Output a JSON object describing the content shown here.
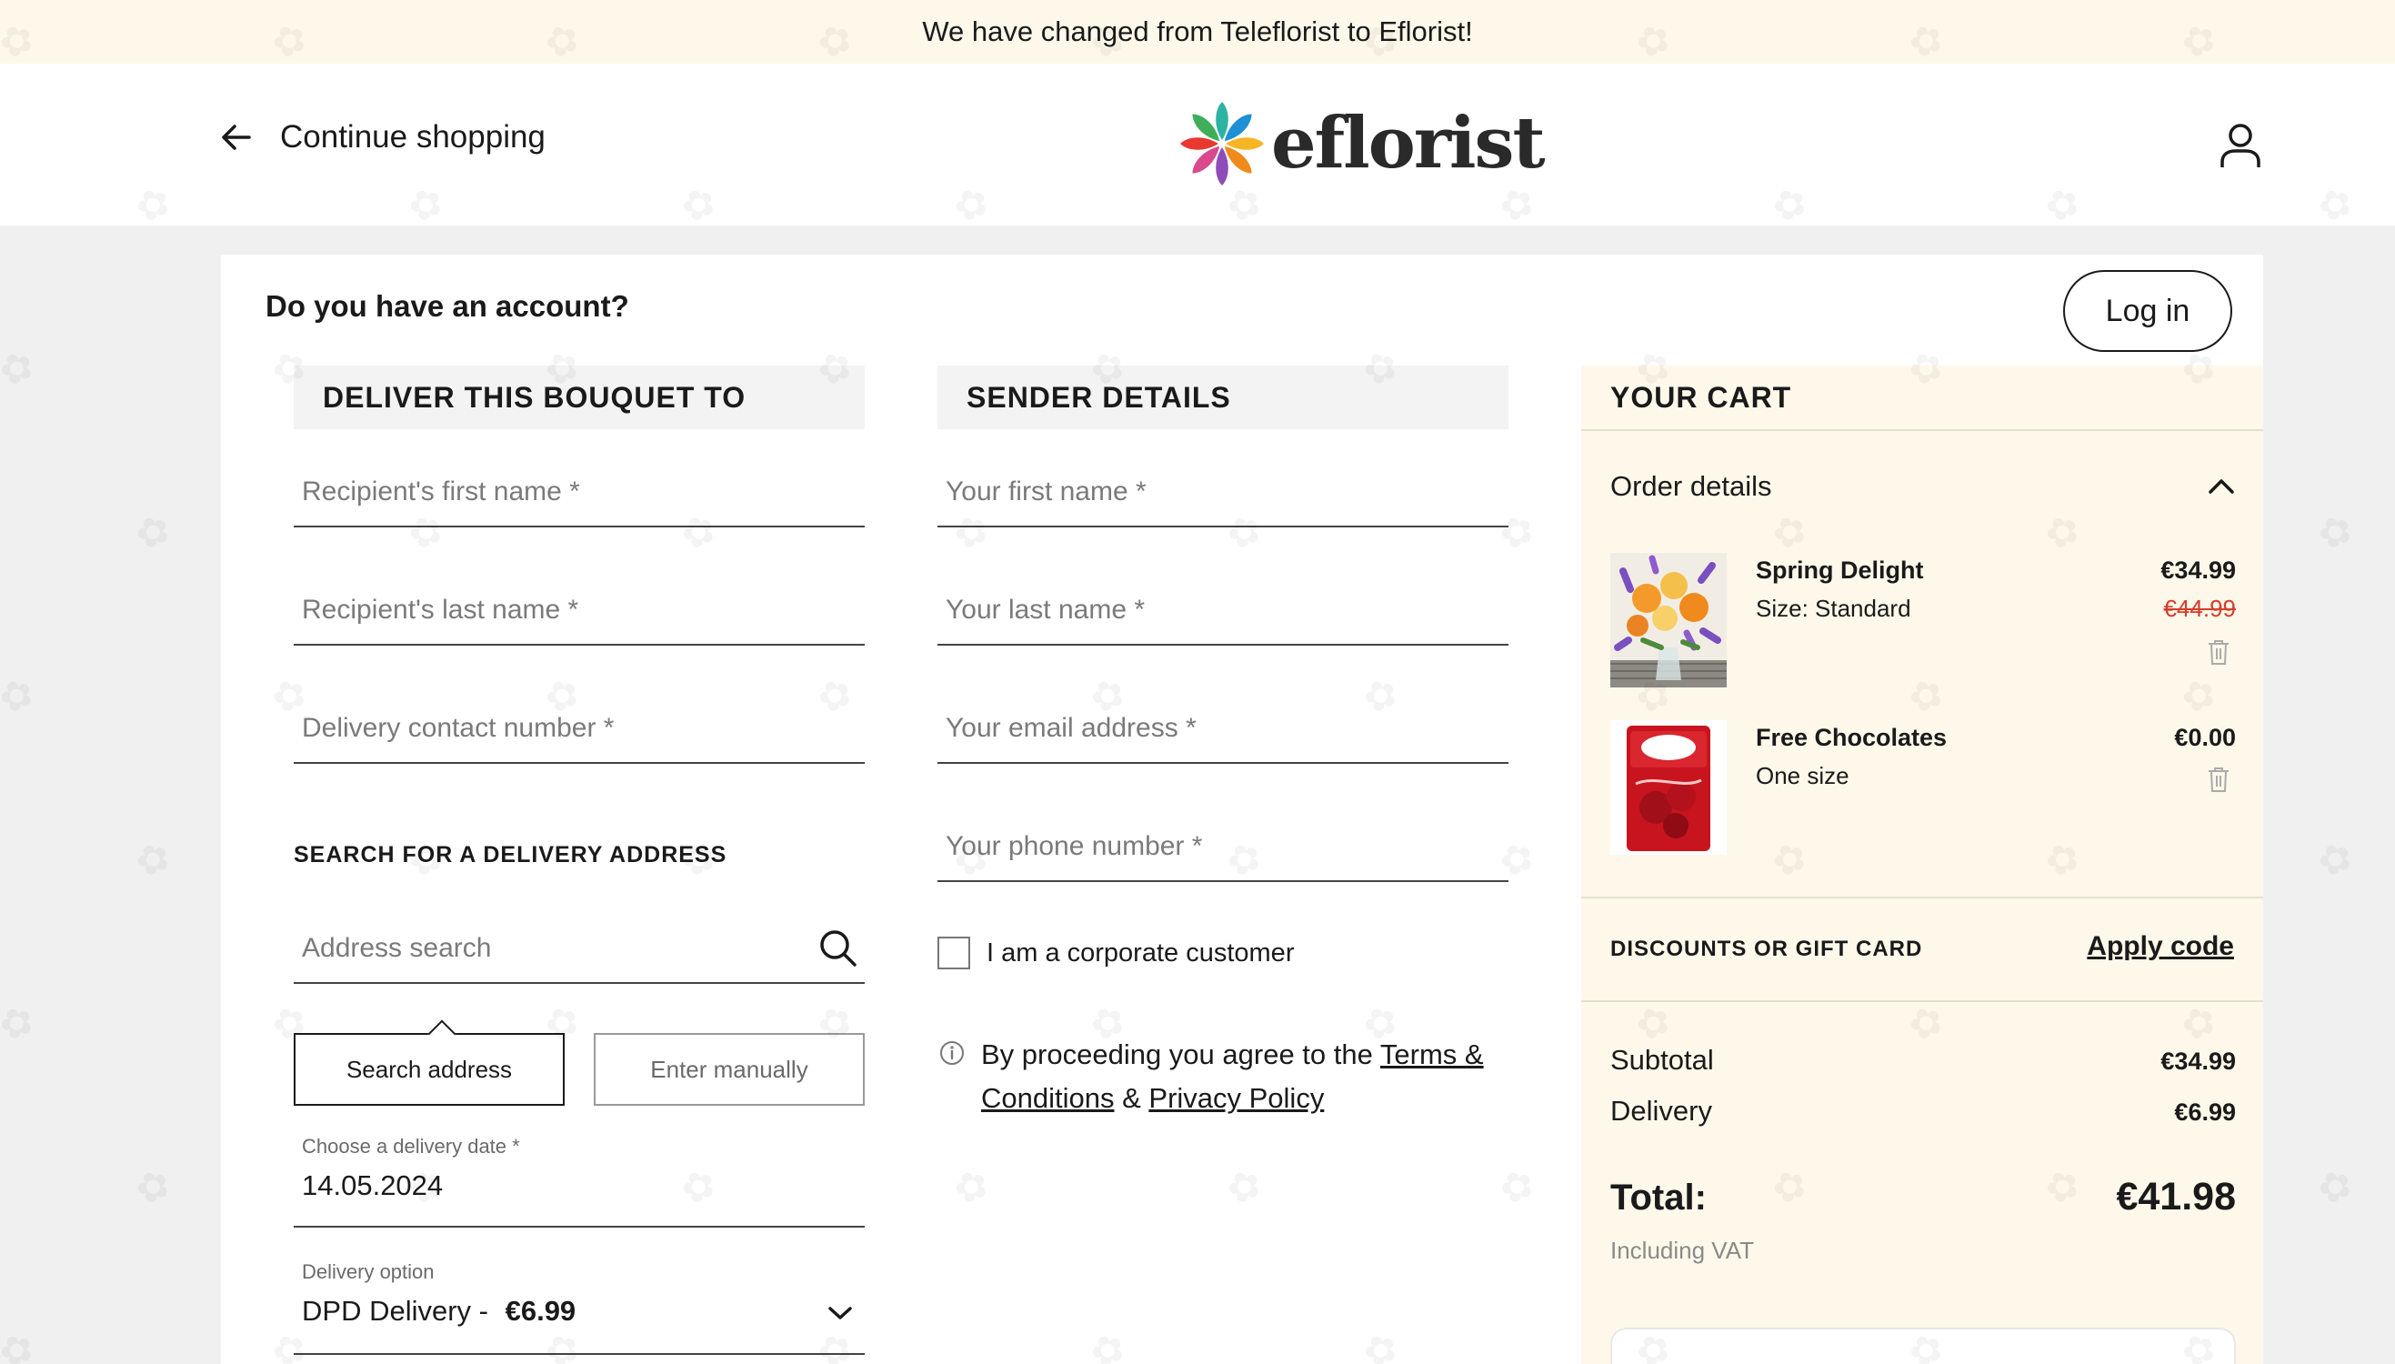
{
  "banner": {
    "text": "We have changed from Teleflorist to Eflorist!"
  },
  "header": {
    "continue_label": "Continue shopping",
    "logo_text": "eflorist",
    "icons": {
      "back": "arrow-left-icon",
      "account": "user-icon"
    }
  },
  "account": {
    "question": "Do you have an account?",
    "login_label": "Log in"
  },
  "deliver": {
    "heading": "DELIVER THIS BOUQUET TO",
    "first_name_placeholder": "Recipient's first name *",
    "last_name_placeholder": "Recipient's last name *",
    "contact_placeholder": "Delivery contact number *",
    "address_heading": "SEARCH FOR A DELIVERY ADDRESS",
    "address_placeholder": "Address search",
    "search_button": "Search address",
    "manual_button": "Enter manually",
    "date_label": "Choose a delivery date *",
    "date_value": "14.05.2024",
    "option_label": "Delivery option",
    "option_value": "DPD Delivery -",
    "option_price": "€6.99"
  },
  "sender": {
    "heading": "SENDER DETAILS",
    "first_name_placeholder": "Your first name *",
    "last_name_placeholder": "Your last name *",
    "email_placeholder": "Your email address *",
    "phone_placeholder": "Your phone number *",
    "corporate_label": "I am a corporate customer",
    "terms_prefix": "By proceeding you agree to the ",
    "terms_link": "Terms & Conditions",
    "terms_and": " & ",
    "privacy_link": "Privacy Policy"
  },
  "cart": {
    "title": "YOUR CART",
    "order_details": "Order details",
    "items": [
      {
        "name": "Spring Delight",
        "meta": "Size: Standard",
        "price": "€34.99",
        "old_price": "€44.99"
      },
      {
        "name": "Free Chocolates",
        "meta": "One size",
        "price": "€0.00"
      }
    ],
    "discount_label": "DISCOUNTS OR GIFT CARD",
    "apply_code": "Apply code",
    "subtotal_label": "Subtotal",
    "subtotal_value": "€34.99",
    "delivery_label": "Delivery",
    "delivery_value": "€6.99",
    "total_label": "Total:",
    "total_value": "€41.98",
    "vat_note": "Including VAT"
  },
  "colors": {
    "banner_bg": "#fdf8ea",
    "cart_bg": "#fdf8ea",
    "strike_price": "#d63b2a",
    "page_bg": "#f0f0f0"
  }
}
